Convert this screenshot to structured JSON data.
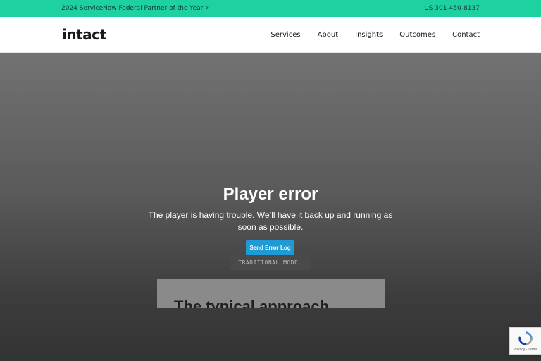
{
  "topbar": {
    "promo_text": "2024 ServiceNow Federal Partner of the Year",
    "promo_chevron": "›",
    "phone": "US 301-450-8137",
    "background_color": "#1ed1a0"
  },
  "header": {
    "logo": "intact",
    "nav": [
      "Services",
      "About",
      "Insights",
      "Outcomes",
      "Contact"
    ]
  },
  "player": {
    "error_title": "Player error",
    "error_message": "The player is having trouble. We’ll have it back up and running as soon as possible.",
    "button_label": "Send Error Log",
    "button_color": "#1e9ad6"
  },
  "section": {
    "tag": "TRADITIONAL MODEL",
    "heading": "The typical approach"
  },
  "recaptcha": {
    "icon": "recaptcha-icon",
    "links": "Privacy - Terms"
  }
}
